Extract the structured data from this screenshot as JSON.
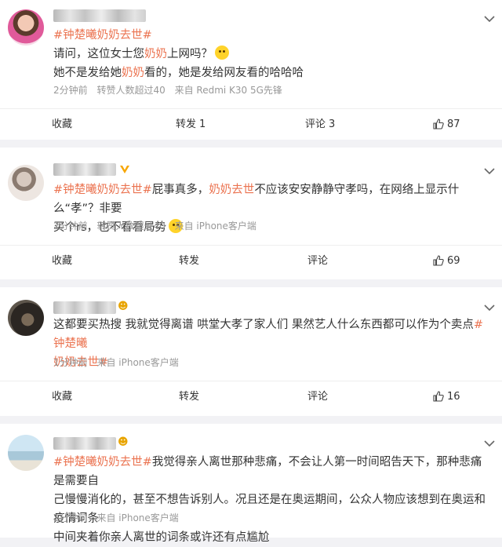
{
  "posts": [
    {
      "hashtag": "#钟楚曦奶奶去世#",
      "line1_a": "请问，这位女士您",
      "line1_hl": "奶奶",
      "line1_b": "上网吗？",
      "line2_a": "她不是发给她",
      "line2_hl": "奶奶",
      "line2_b": "看的，她是发给网友看的哈哈哈",
      "time": "2分钟前",
      "likes_info": "转赞人数超过40",
      "source": "来自 Redmi K30 5G先锋",
      "fav": "收藏",
      "repost": "转发",
      "repost_count": "1",
      "comment": "评论",
      "comment_count": "3",
      "like_count": "87"
    },
    {
      "hashtag": "#钟楚曦奶奶去世#",
      "text_a": "屁事真多，",
      "text_hl": "奶奶去世",
      "text_b": "不应该安安静静守孝吗，在网络上显示什么“孝”？非要",
      "line2": "买个rs，也不看看局势",
      "time": "2分钟前",
      "likes_info": "转赞人数超过40",
      "source": "来自 iPhone客户端",
      "fav": "收藏",
      "repost": "转发",
      "comment": "评论",
      "like_count": "69"
    },
    {
      "text_a": "这都要买热搜 我就觉得离谱 哄堂大孝了家人们 果然艺人什么东西都可以作为个卖点",
      "hashtag_a": "#钟楚曦",
      "hashtag_b": "奶奶去世#",
      "time": "1分钟前",
      "source": "来自 iPhone客户端",
      "fav": "收藏",
      "repost": "转发",
      "comment": "评论",
      "like_count": "16"
    },
    {
      "hashtag": "#钟楚曦奶奶去世#",
      "text_a": "我觉得亲人离世那种悲痛，不会让人第一时间昭告天下，那种悲痛是需要自",
      "line2": "己慢慢消化的，甚至不想告诉别人。况且还是在奥运期间，公众人物应该想到在奥运和疫情词条",
      "line3": "中间夹着你亲人离世的词条或许还有点尴尬",
      "time": "2分钟前",
      "source": "来自 iPhone客户端"
    }
  ],
  "colors": {
    "accent": "#eb7350",
    "meta": "#999999",
    "bg": "#f2f2f5"
  }
}
